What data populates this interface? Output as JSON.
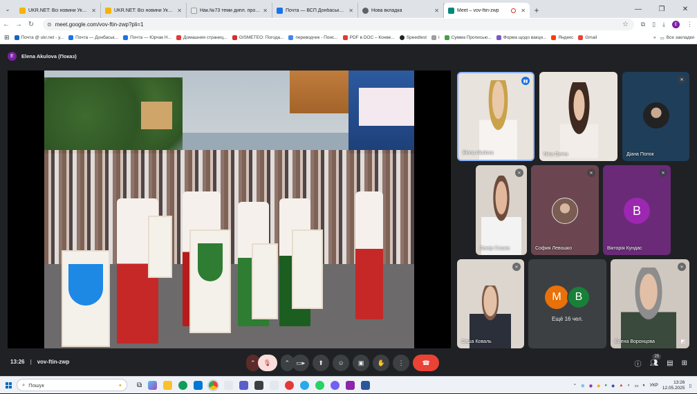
{
  "browser": {
    "tabs": [
      {
        "title": "UKR.NET: Всі новини України,",
        "color": "#f4b400"
      },
      {
        "title": "UKR.NET: Всі новини України,",
        "color": "#f4b400"
      },
      {
        "title": "Нак.№73 теми дипл. проектів",
        "color": "#e8e8e8"
      },
      {
        "title": "Почта — ВСП Донбаський агр",
        "color": "#1a73e8"
      },
      {
        "title": "Нова вкладка",
        "color": "#5f6368"
      },
      {
        "title": "Meet – vov-ftin-zwp",
        "color": "#00897b"
      }
    ],
    "url": "meet.google.com/vov-ftin-zwp?pli=1",
    "profile_letter": "E",
    "bookmarks": [
      {
        "label": "Почта @ ukr.net - у...",
        "color": "#1565c0"
      },
      {
        "label": "Почта — Донбаськ...",
        "color": "#1a73e8"
      },
      {
        "label": "Почта — Юрчак Н...",
        "color": "#1a73e8"
      },
      {
        "label": "Домашняя страниц...",
        "color": "#e53935"
      },
      {
        "label": "GISMETEO: Погода...",
        "color": "#d32f2f"
      },
      {
        "label": "переводчик - Поис...",
        "color": "#4285f4"
      },
      {
        "label": "PDF в DOC – Конве...",
        "color": "#e53935"
      },
      {
        "label": "Speedtest",
        "color": "#222222"
      },
      {
        "label": "i",
        "color": "#9e9e9e"
      },
      {
        "label": "Сумма Прописью...",
        "color": "#43a047"
      },
      {
        "label": "Форма щодо вакци...",
        "color": "#7e57c2"
      },
      {
        "label": "Яндекс",
        "color": "#ff3d00"
      },
      {
        "label": "Gmail",
        "color": "#ea4335"
      }
    ],
    "bookmarks_more": "»",
    "bookmarks_all": "Все закладки"
  },
  "meet": {
    "presenter": {
      "letter": "E",
      "label": "Elena Akulova (Показ)"
    },
    "participants": [
      {
        "name": "Elena Akulova",
        "state": "speaking"
      },
      {
        "name": "Nina Goma",
        "state": "none"
      },
      {
        "name": "Діана Попок",
        "state": "muted"
      },
      {
        "name": "Захар Сошка",
        "state": "muted"
      },
      {
        "name": "София Левошко",
        "state": "muted"
      },
      {
        "name": "Вікторія Кундас",
        "state": "muted",
        "letter": "В"
      },
      {
        "name": "Саша Коваль",
        "state": "muted"
      },
      {
        "name": "Елена Воронцова",
        "state": "muted"
      }
    ],
    "more_tile": {
      "letters": [
        "M",
        "B"
      ],
      "label": "Ещё 16 чел."
    },
    "time": "13:26",
    "meeting_code": "vov-ftin-zwp",
    "participant_count": "25"
  },
  "taskbar": {
    "search": "Пошук",
    "lang": "УКР",
    "time": "13:26",
    "date": "12.05.2025"
  }
}
